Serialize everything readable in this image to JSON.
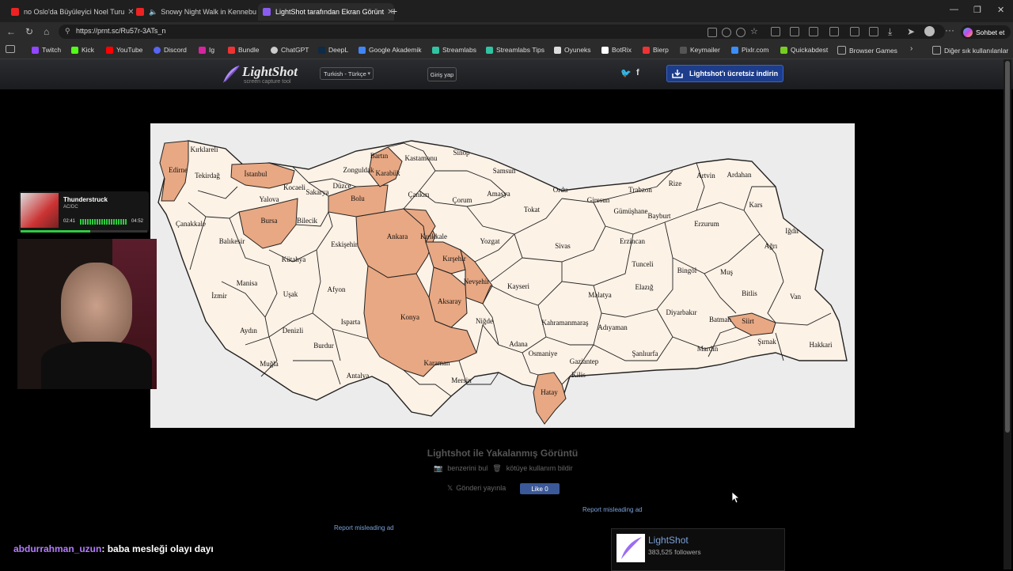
{
  "browser": {
    "tabs": [
      {
        "title": "no Oslo'da Büyüleyici Noel Turu",
        "favicon": "youtube-icon"
      },
      {
        "title": "Snowy Night Walk in Kennebu",
        "favicon": "youtube-icon"
      },
      {
        "title": "LightShot tarafından Ekran Görünt",
        "favicon": "lightshot-icon"
      }
    ],
    "url": "https://prnt.sc/Ru57r-3ATs_n",
    "sohbet_label": "Sohbet et",
    "bookmarks": [
      "Twitch",
      "Kick",
      "YouTube",
      "Discord",
      "Ig",
      "Bundle",
      "ChatGPT",
      "DeepL",
      "Google Akademik",
      "Streamlabs",
      "Streamlabs Tips",
      "Oyuneks",
      "BotRix",
      "Bierp",
      "Keymailer",
      "Pixlr.com",
      "Quickabdest",
      "Browser Games"
    ],
    "other_bookmarks": "Diğer sık kullanılanlar"
  },
  "lightshot": {
    "logo_name": "LightShot",
    "logo_tagline": "screen capture tool",
    "language": "Turkish - Türkçe",
    "login": "Giriş yap",
    "download": "Lightshot'ı ücretsiz indirin",
    "caption": "Lightshot ile Yakalanmış Görüntü",
    "find_similar": "benzerini bul",
    "report_abuse": "kötüye kullanım bildir",
    "post": "Gönderi yayınla",
    "like": "Like 0",
    "report_ad_1": "Report misleading ad",
    "report_ad_2": "Report misleading ad",
    "card_name": "LightShot",
    "card_followers": "383,525 followers"
  },
  "stream": {
    "song_title": "Thunderstruck",
    "song_artist": "AC/DC",
    "time_elapsed": "02:41",
    "time_total": "04:52",
    "chat_user": "abdurrahman_uzun",
    "chat_message": ": baba mesleği olayı dayı"
  },
  "map": {
    "colors": {
      "base": "#fdf2e6",
      "highlight": "#e8a883",
      "border": "#222222",
      "background": "#ececec"
    },
    "provinces": [
      {
        "name": "Kırklareli",
        "highlighted": false
      },
      {
        "name": "Edirne",
        "highlighted": true
      },
      {
        "name": "Tekirdağ",
        "highlighted": false
      },
      {
        "name": "İstanbul",
        "highlighted": true
      },
      {
        "name": "Kocaeli",
        "highlighted": false
      },
      {
        "name": "Yalova",
        "highlighted": false
      },
      {
        "name": "Sakarya",
        "highlighted": false
      },
      {
        "name": "Düzce",
        "highlighted": false
      },
      {
        "name": "Zonguldak",
        "highlighted": false
      },
      {
        "name": "Bartın",
        "highlighted": true
      },
      {
        "name": "Karabük",
        "highlighted": true
      },
      {
        "name": "Kastamonu",
        "highlighted": false
      },
      {
        "name": "Sinop",
        "highlighted": false
      },
      {
        "name": "Samsun",
        "highlighted": false
      },
      {
        "name": "Ordu",
        "highlighted": false
      },
      {
        "name": "Giresun",
        "highlighted": false
      },
      {
        "name": "Trabzon",
        "highlighted": false
      },
      {
        "name": "Rize",
        "highlighted": false
      },
      {
        "name": "Artvin",
        "highlighted": false
      },
      {
        "name": "Ardahan",
        "highlighted": false
      },
      {
        "name": "Kars",
        "highlighted": false
      },
      {
        "name": "Iğdır",
        "highlighted": false
      },
      {
        "name": "Erzurum",
        "highlighted": false
      },
      {
        "name": "Bayburt",
        "highlighted": false
      },
      {
        "name": "Gümüşhane",
        "highlighted": false
      },
      {
        "name": "Çanakkale",
        "highlighted": false
      },
      {
        "name": "Bursa",
        "highlighted": true
      },
      {
        "name": "Bilecik",
        "highlighted": false
      },
      {
        "name": "Bolu",
        "highlighted": true
      },
      {
        "name": "Çankırı",
        "highlighted": false
      },
      {
        "name": "Çorum",
        "highlighted": false
      },
      {
        "name": "Amasya",
        "highlighted": false
      },
      {
        "name": "Tokat",
        "highlighted": false
      },
      {
        "name": "Balıkesir",
        "highlighted": false
      },
      {
        "name": "Eskişehir",
        "highlighted": false
      },
      {
        "name": "Ankara",
        "highlighted": true
      },
      {
        "name": "Kırıkkale",
        "highlighted": true
      },
      {
        "name": "Yozgat",
        "highlighted": false
      },
      {
        "name": "Sivas",
        "highlighted": false
      },
      {
        "name": "Erzincan",
        "highlighted": false
      },
      {
        "name": "Tunceli",
        "highlighted": false
      },
      {
        "name": "Bingöl",
        "highlighted": false
      },
      {
        "name": "Muş",
        "highlighted": false
      },
      {
        "name": "Ağrı",
        "highlighted": false
      },
      {
        "name": "Van",
        "highlighted": false
      },
      {
        "name": "Kütahya",
        "highlighted": false
      },
      {
        "name": "Kırşehir",
        "highlighted": true
      },
      {
        "name": "Nevşehir",
        "highlighted": true
      },
      {
        "name": "Kayseri",
        "highlighted": false
      },
      {
        "name": "Malatya",
        "highlighted": false
      },
      {
        "name": "Elazığ",
        "highlighted": false
      },
      {
        "name": "Bitlis",
        "highlighted": false
      },
      {
        "name": "Manisa",
        "highlighted": false
      },
      {
        "name": "Uşak",
        "highlighted": false
      },
      {
        "name": "Afyon",
        "highlighted": false
      },
      {
        "name": "Aksaray",
        "highlighted": true
      },
      {
        "name": "İzmir",
        "highlighted": false
      },
      {
        "name": "Konya",
        "highlighted": true
      },
      {
        "name": "Niğde",
        "highlighted": false
      },
      {
        "name": "Kahramanmaraş",
        "highlighted": false
      },
      {
        "name": "Adıyaman",
        "highlighted": false
      },
      {
        "name": "Diyarbakır",
        "highlighted": false
      },
      {
        "name": "Batman",
        "highlighted": false
      },
      {
        "name": "Siirt",
        "highlighted": true
      },
      {
        "name": "Şırnak",
        "highlighted": false
      },
      {
        "name": "Hakkari",
        "highlighted": false
      },
      {
        "name": "Aydın",
        "highlighted": false
      },
      {
        "name": "Denizli",
        "highlighted": false
      },
      {
        "name": "Isparta",
        "highlighted": false
      },
      {
        "name": "Burdur",
        "highlighted": false
      },
      {
        "name": "Adana",
        "highlighted": false
      },
      {
        "name": "Osmaniye",
        "highlighted": false
      },
      {
        "name": "Gaziantep",
        "highlighted": false
      },
      {
        "name": "Şanlıurfa",
        "highlighted": false
      },
      {
        "name": "Mardin",
        "highlighted": false
      },
      {
        "name": "Muğla",
        "highlighted": false
      },
      {
        "name": "Antalya",
        "highlighted": false
      },
      {
        "name": "Karaman",
        "highlighted": false
      },
      {
        "name": "Mersin",
        "highlighted": false
      },
      {
        "name": "Kilis",
        "highlighted": false
      },
      {
        "name": "Hatay",
        "highlighted": true
      }
    ]
  }
}
